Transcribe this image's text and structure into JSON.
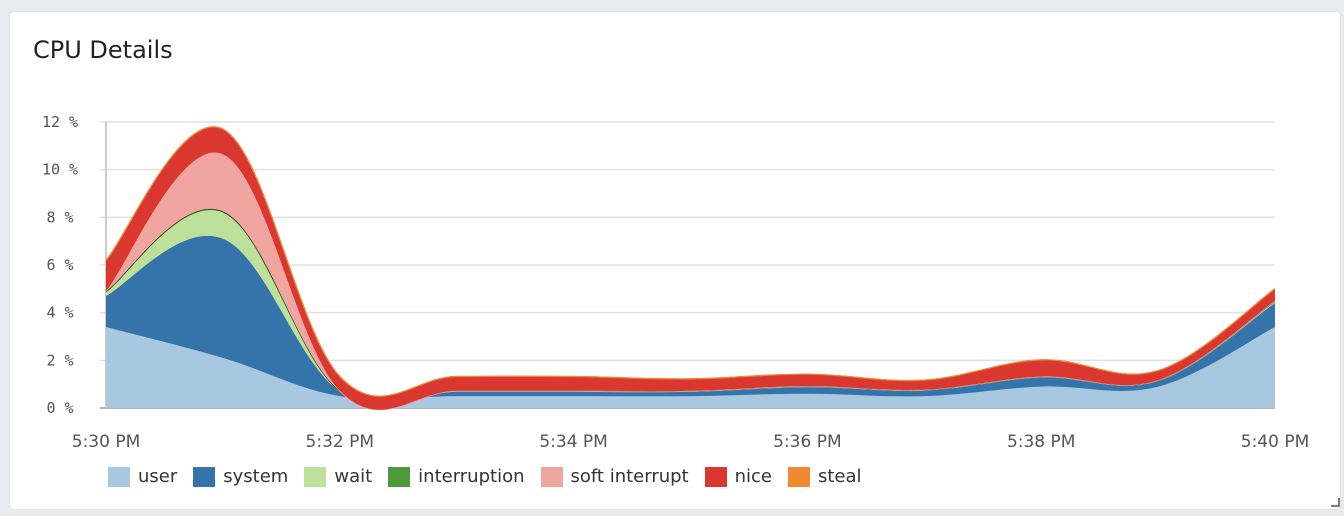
{
  "panel": {
    "title": "CPU Details"
  },
  "chart_data": {
    "type": "area",
    "stacked": true,
    "title": "CPU Details",
    "x": [
      "5:30 PM",
      "5:31 PM",
      "5:32 PM",
      "5:33 PM",
      "5:34 PM",
      "5:35 PM",
      "5:36 PM",
      "5:37 PM",
      "5:38 PM",
      "5:39 PM",
      "5:40 PM"
    ],
    "x_tick_labels": [
      "5:30 PM",
      "5:32 PM",
      "5:34 PM",
      "5:36 PM",
      "5:38 PM",
      "5:40 PM"
    ],
    "y_tick_labels": [
      "0 %",
      "2 %",
      "4 %",
      "6 %",
      "8 %",
      "10 %",
      "12 %"
    ],
    "ylim": [
      0,
      12
    ],
    "grid": true,
    "legend_position": "bottom-left",
    "series": [
      {
        "name": "user",
        "color": "#a8c8df",
        "values": [
          3.4,
          2.1,
          0.5,
          0.5,
          0.5,
          0.5,
          0.6,
          0.5,
          0.9,
          0.9,
          3.4
        ]
      },
      {
        "name": "system",
        "color": "#3573ab",
        "values": [
          1.3,
          5.0,
          0.2,
          0.2,
          0.2,
          0.2,
          0.3,
          0.25,
          0.4,
          0.25,
          1.0
        ]
      },
      {
        "name": "wait",
        "color": "#bde19b",
        "values": [
          0.15,
          1.1,
          0.0,
          0.0,
          0.0,
          0.0,
          0.0,
          0.0,
          0.0,
          0.0,
          0.05
        ]
      },
      {
        "name": "interruption",
        "color": "#4e9a3a",
        "values": [
          0.05,
          0.05,
          0.02,
          0.02,
          0.02,
          0.02,
          0.02,
          0.02,
          0.02,
          0.02,
          0.05
        ]
      },
      {
        "name": "soft interrupt",
        "color": "#f0a5a1",
        "values": [
          0.0,
          2.4,
          0.0,
          0.0,
          0.0,
          0.0,
          0.0,
          0.0,
          0.0,
          0.0,
          0.0
        ]
      },
      {
        "name": "nice",
        "color": "#d9372f",
        "values": [
          1.3,
          1.05,
          0.6,
          0.6,
          0.6,
          0.5,
          0.5,
          0.4,
          0.7,
          0.4,
          0.5
        ]
      },
      {
        "name": "steal",
        "color": "#f08a32",
        "values": [
          0,
          0,
          0,
          0,
          0,
          0,
          0,
          0,
          0,
          0,
          0
        ]
      }
    ]
  }
}
